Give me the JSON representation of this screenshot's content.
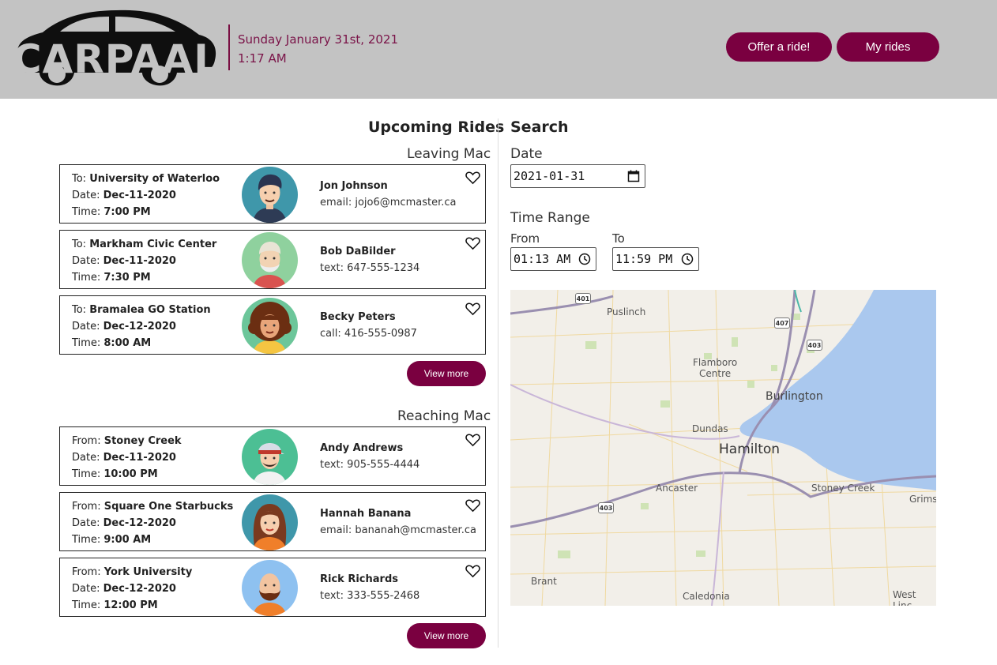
{
  "header": {
    "logo_text": "CARPAAL",
    "date": "Sunday January 31st, 2021",
    "time": "1:17 AM",
    "offer_label": "Offer a ride!",
    "myrides_label": "My rides"
  },
  "upcoming": {
    "title": "Upcoming Rides",
    "leaving": {
      "title": "Leaving Mac",
      "view_more": "View more",
      "rides": [
        {
          "dir": "To:",
          "place": "University of Waterloo",
          "date_label": "Date:",
          "date": "Dec-11-2020",
          "time_label": "Time:",
          "time": "7:00 PM",
          "name": "Jon Johnson",
          "contact": "email: jojo6@mcmaster.ca"
        },
        {
          "dir": "To:",
          "place": "Markham Civic Center",
          "date_label": "Date:",
          "date": "Dec-11-2020",
          "time_label": "Time:",
          "time": "7:30 PM",
          "name": "Bob DaBilder",
          "contact": "text: 647-555-1234"
        },
        {
          "dir": "To:",
          "place": "Bramalea GO Station",
          "date_label": "Date:",
          "date": "Dec-12-2020",
          "time_label": "Time:",
          "time": "8:00 AM",
          "name": "Becky Peters",
          "contact": "call: 416-555-0987"
        }
      ]
    },
    "reaching": {
      "title": "Reaching Mac",
      "view_more": "View more",
      "rides": [
        {
          "dir": "From:",
          "place": "Stoney Creek",
          "date_label": "Date:",
          "date": "Dec-11-2020",
          "time_label": "Time:",
          "time": "10:00 PM",
          "name": "Andy Andrews",
          "contact": "text: 905-555-4444"
        },
        {
          "dir": "From:",
          "place": "Square One Starbucks",
          "date_label": "Date:",
          "date": "Dec-12-2020",
          "time_label": "Time:",
          "time": "9:00 AM",
          "name": "Hannah Banana",
          "contact": "email: bananah@mcmaster.ca"
        },
        {
          "dir": "From:",
          "place": "York University",
          "date_label": "Date:",
          "date": "Dec-12-2020",
          "time_label": "Time:",
          "time": "12:00 PM",
          "name": "Rick Richards",
          "contact": "text: 333-555-2468"
        }
      ]
    }
  },
  "search": {
    "title": "Search",
    "date_label": "Date",
    "date_value": "2021-01-31",
    "time_range_label": "Time Range",
    "from_label": "From",
    "from_value": "01:13 AM",
    "to_label": "To",
    "to_value": "11:59 PM"
  },
  "map": {
    "labels": {
      "puslinch": "Puslinch",
      "flamboro": "Flamboro",
      "centre": "Centre",
      "burlington": "Burlington",
      "dundas": "Dundas",
      "hamilton": "Hamilton",
      "ancaster": "Ancaster",
      "stoney_creek": "Stoney Creek",
      "grims": "Grims",
      "brant": "Brant",
      "caledonia": "Caledonia",
      "west_linc": "West Linc"
    },
    "shields": {
      "h401": "401",
      "h407": "407",
      "h403a": "403",
      "h403b": "403"
    },
    "colors": {
      "land": "#f2efe9",
      "water": "#aac8ee",
      "highway": "#9a8fb0",
      "road": "#f0d9a0"
    }
  },
  "colors": {
    "brand": "#7a0040",
    "header_bg": "#c3c3c3",
    "date_text": "#7a1348"
  },
  "icons": {
    "heart": "heart-outline-icon",
    "calendar": "calendar-icon",
    "clock": "clock-icon"
  }
}
